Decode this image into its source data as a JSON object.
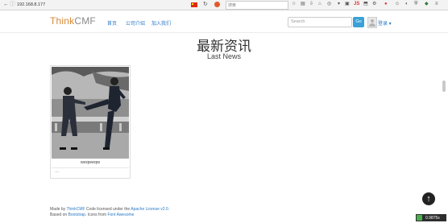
{
  "browser": {
    "url": "192.168.8.177",
    "search_placeholder": "搜索"
  },
  "site": {
    "logo": {
      "accent": "T",
      "main": "hink",
      "suffix": "CMF"
    },
    "menu": [
      "首页",
      "公司介绍",
      "加入我们"
    ],
    "search_placeholder": "Search",
    "go_label": "Go",
    "login_label": "登录 ▾"
  },
  "page": {
    "title_cn": "最新资讯",
    "title_en": "Last News"
  },
  "card": {
    "title": "weqweqw",
    "more": "..."
  },
  "footer": {
    "line1_prefix": "Made by ",
    "line1_link1": "ThinkCMF",
    "line1_mid": " Code licensed under the ",
    "line1_link2": "Apache License v2.0.",
    "line2_prefix": "Based on ",
    "line2_link1": "Bootstrap",
    "line2_mid": ". Icons from ",
    "line2_link2": "Font Awesome"
  },
  "status": {
    "speed": "0.9875s"
  },
  "colors": {
    "link": "#2a7ac7",
    "logo_accent": "#d9893a",
    "go_button": "#3aa1d8"
  }
}
